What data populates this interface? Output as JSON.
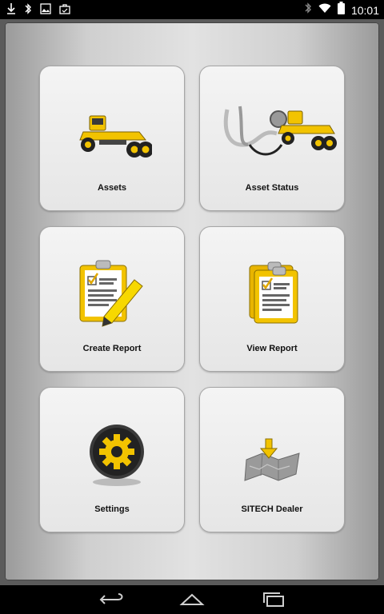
{
  "status_bar": {
    "time": "10:01",
    "left_icons": [
      "download-icon",
      "bluetooth-icon",
      "image-icon",
      "briefcase-icon"
    ],
    "right_icons": [
      "bluetooth-icon",
      "wifi-icon",
      "battery-icon"
    ]
  },
  "menu": {
    "tiles": [
      {
        "label": "Assets",
        "icon": "motor-grader-icon"
      },
      {
        "label": "Asset Status",
        "icon": "stethoscope-grader-icon"
      },
      {
        "label": "Create Report",
        "icon": "clipboard-pencil-icon"
      },
      {
        "label": "View Report",
        "icon": "clipboard-stack-icon"
      },
      {
        "label": "Settings",
        "icon": "gear-icon"
      },
      {
        "label": "SITECH Dealer",
        "icon": "map-pin-icon"
      }
    ]
  },
  "nav_bar": {
    "buttons": [
      "back-icon",
      "home-icon",
      "recents-icon"
    ]
  },
  "colors": {
    "accent_yellow": "#f2c300",
    "status_bar_bg": "#000000"
  }
}
